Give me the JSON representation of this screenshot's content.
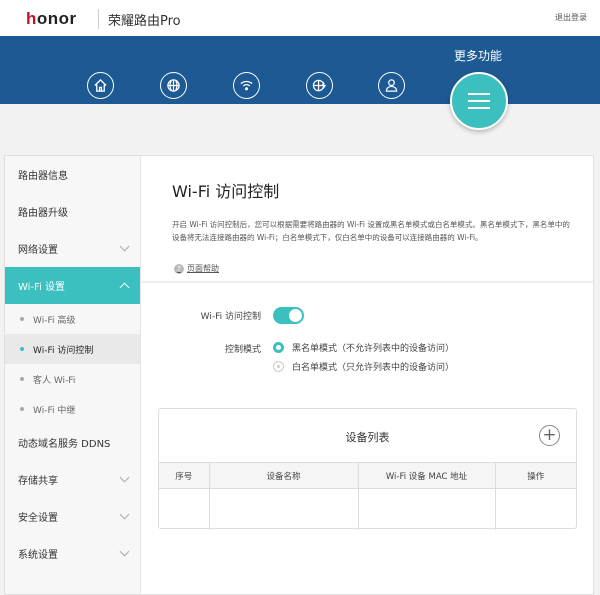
{
  "header": {
    "logo": "honor",
    "logo_small": "荣耀",
    "product": "荣耀路由Pro",
    "logout": "退出登录"
  },
  "nav": {
    "items": [
      "home",
      "internet",
      "wifi",
      "more-internet",
      "user"
    ],
    "more_label": "更多功能"
  },
  "sidebar": {
    "items": [
      {
        "label": "路由器信息"
      },
      {
        "label": "路由器升级"
      },
      {
        "label": "网络设置"
      },
      {
        "label": "Wi-Fi 设置"
      },
      {
        "label": "动态域名服务 DDNS"
      },
      {
        "label": "存储共享"
      },
      {
        "label": "安全设置"
      },
      {
        "label": "系统设置"
      }
    ],
    "sub": [
      {
        "label": "Wi-Fi 高级"
      },
      {
        "label": "Wi-Fi 访问控制"
      },
      {
        "label": "客人 Wi-Fi"
      },
      {
        "label": "Wi-Fi 中继"
      }
    ]
  },
  "main": {
    "title": "Wi-Fi 访问控制",
    "desc": "开启 Wi-Fi 访问控制后，您可以根据需要将路由器的 Wi-Fi 设置成黑名单模式或白名单模式。黑名单模式下，黑名单中的设备将无法连接路由器的 Wi-Fi；白名单模式下，仅白名单中的设备可以连接路由器的 Wi-Fi。",
    "help": "页面帮助",
    "toggle_label": "Wi-Fi 访问控制",
    "toggle_on": true,
    "mode_label": "控制模式",
    "modes": [
      "黑名单模式（不允许列表中的设备访问）",
      "白名单模式（只允许列表中的设备访问）"
    ],
    "device_list": {
      "title": "设备列表",
      "columns": [
        "序号",
        "设备名称",
        "Wi-Fi 设备 MAC 地址",
        "操作"
      ]
    }
  },
  "colors": {
    "accent": "#3bbfbf",
    "band": "#1d5a93"
  }
}
